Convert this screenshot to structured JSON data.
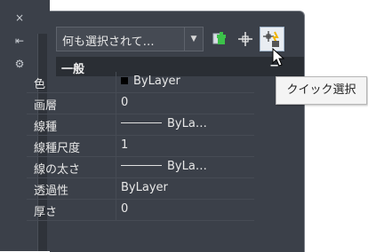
{
  "sidebar": {
    "close_icon": "×",
    "pin_icon": "⇤",
    "settings_icon": "⚙"
  },
  "toolbar": {
    "selection_dropdown_value": "何も選択されて…",
    "dropdown_icon": "chevron-down-icon",
    "toggle_pickadd_icon": "pickadd-icon",
    "select_objects_icon": "crosshair-icon",
    "quick_select_icon": "quick-select-icon"
  },
  "tooltip": {
    "text": "クイック選択"
  },
  "section": {
    "title": "一般",
    "collapse_symbol": "−"
  },
  "properties": [
    {
      "name": "色",
      "value": "ByLayer",
      "type": "color",
      "swatch": "#000000"
    },
    {
      "name": "画層",
      "value": "0"
    },
    {
      "name": "線種",
      "value": "ByLa…",
      "type": "line"
    },
    {
      "name": "線種尺度",
      "value": "1"
    },
    {
      "name": "線の太さ",
      "value": "ByLa…",
      "type": "line"
    },
    {
      "name": "透過性",
      "value": "ByLayer"
    },
    {
      "name": "厚さ",
      "value": "0"
    }
  ]
}
